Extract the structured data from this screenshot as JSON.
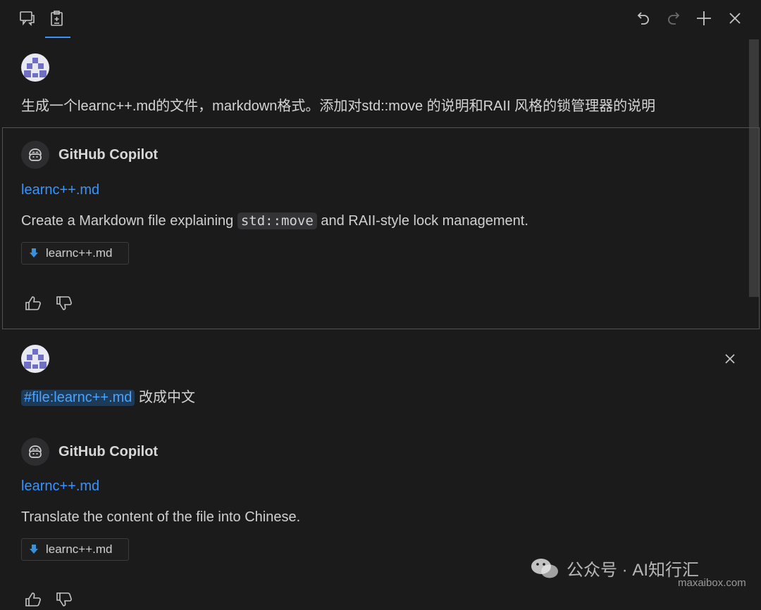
{
  "toolbar": {
    "tabs": [
      {
        "icon": "chat-icon"
      },
      {
        "icon": "edit-session-icon"
      }
    ],
    "actions": [
      {
        "icon": "undo-icon"
      },
      {
        "icon": "redo-icon"
      },
      {
        "icon": "plus-icon"
      },
      {
        "icon": "close-icon"
      }
    ]
  },
  "exchanges": [
    {
      "user_prompt": "生成一个learnc++.md的文件，markdown格式。添加对std::move 的说明和RAII 风格的锁管理器的说明",
      "response": {
        "author": "GitHub Copilot",
        "file_link": "learnc++.md",
        "text_before_code": "Create a Markdown file explaining ",
        "code": "std::move",
        "text_after_code": " and RAII-style lock management.",
        "file_chip": "learnc++.md"
      }
    },
    {
      "user_prompt_ref": "#file:learnc++.md",
      "user_prompt_suffix": " 改成中文",
      "response": {
        "author": "GitHub Copilot",
        "file_link": "learnc++.md",
        "text": "Translate the content of the file into Chinese.",
        "file_chip": "learnc++.md"
      }
    }
  ],
  "watermark": {
    "text": "公众号 · AI知行汇",
    "site": "maxaibox.com"
  },
  "colors": {
    "background": "#1b1b1c",
    "accent": "#3794ff",
    "focus_border": "#1f5f9e"
  }
}
